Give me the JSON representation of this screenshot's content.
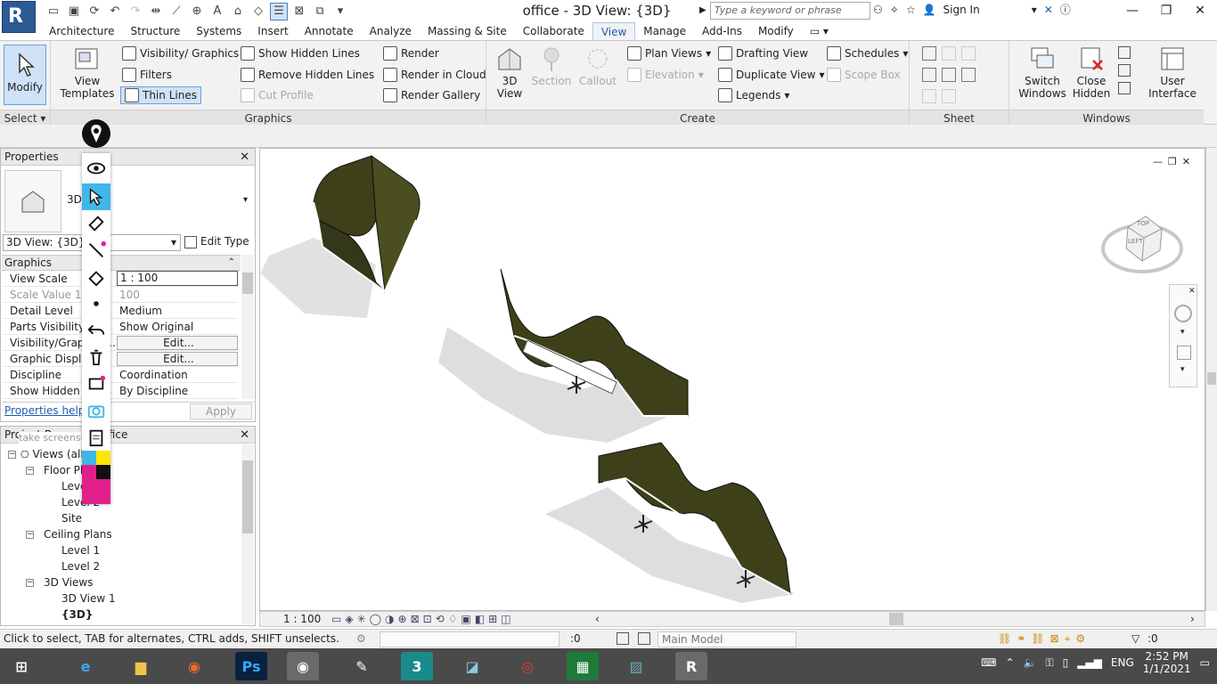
{
  "app": {
    "logo": "R",
    "title": "office - 3D View: {3D}"
  },
  "search": {
    "placeholder": "Type a keyword or phrase"
  },
  "account": {
    "sign_in": "Sign In"
  },
  "tabs": [
    "Architecture",
    "Structure",
    "Systems",
    "Insert",
    "Annotate",
    "Analyze",
    "Massing & Site",
    "Collaborate",
    "View",
    "Manage",
    "Add-Ins",
    "Modify"
  ],
  "active_tab": "View",
  "ribbon": {
    "select_panel": {
      "modify": "Modify",
      "select": "Select"
    },
    "graphics": {
      "view_templates": "View Templates",
      "visibility_graphics": "Visibility/ Graphics",
      "filters": "Filters",
      "thin_lines": "Thin Lines",
      "show_hidden_lines": "Show  Hidden Lines",
      "remove_hidden_lines": "Remove  Hidden Lines",
      "cut_profile": "Cut  Profile",
      "render": "Render",
      "render_in_cloud": "Render  in Cloud",
      "render_gallery": "Render  Gallery",
      "footer": "Graphics"
    },
    "create": {
      "view_3d": "3D View",
      "section": "Section",
      "callout": "Callout",
      "plan_views": "Plan  Views",
      "elevation": "Elevation",
      "drafting_view": "Drafting  View",
      "duplicate_view": "Duplicate  View",
      "legends": "Legends",
      "schedules": "Schedules",
      "scope_box": "Scope  Box",
      "footer": "Create"
    },
    "sheet": {
      "footer": "Sheet Composition"
    },
    "windows": {
      "switch_windows": "Switch Windows",
      "close_hidden": "Close Hidden",
      "user_interface": "User Interface",
      "footer": "Windows"
    }
  },
  "properties": {
    "title": "Properties",
    "type_label": "3D",
    "selector": "3D View: {3D}",
    "edit_type": "Edit Type",
    "section": "Graphics",
    "rows": [
      {
        "key": "View Scale",
        "value": "1 : 100"
      },
      {
        "key": "Scale Value",
        "prefix": "1:",
        "value": "100"
      },
      {
        "key": "Detail Level",
        "value": "Medium"
      },
      {
        "key": "Parts Visibility",
        "value": "Show Original"
      },
      {
        "key": "Visibility/Graphics...",
        "value": "Edit..."
      },
      {
        "key": "Graphic Display...",
        "value": "Edit..."
      },
      {
        "key": "Discipline",
        "value": "Coordination"
      },
      {
        "key": "Show Hidden Lines",
        "value": "By Discipline"
      }
    ],
    "help": "Properties help",
    "apply": "Apply"
  },
  "browser": {
    "title": "Project Browser - office",
    "tooltip": "take screensho",
    "root": "Views (all)",
    "floor_plans": "Floor Plans",
    "fp_items": [
      "Level 1",
      "Level 2",
      "Site"
    ],
    "ceiling_plans": "Ceiling Plans",
    "cp_items": [
      "Level 1",
      "Level 2"
    ],
    "views_3d": "3D Views",
    "v3_items": [
      "3D View 1",
      "{3D}"
    ]
  },
  "viewcube": {
    "top": "TOP",
    "left": "LEFT"
  },
  "viewbar": {
    "scale": "1 : 100"
  },
  "status": {
    "hint": "Click to select, TAB for alternates, CTRL adds, SHIFT unselects.",
    "count": ":0",
    "model": "Main Model",
    "filter": ":0"
  },
  "tray": {
    "lang": "ENG",
    "time": "2:52 PM",
    "date": "1/1/2021"
  },
  "colors": {
    "accent": "#1e5db3",
    "panel_green": "#3d4019",
    "taskbar": "#4a4a4a"
  }
}
